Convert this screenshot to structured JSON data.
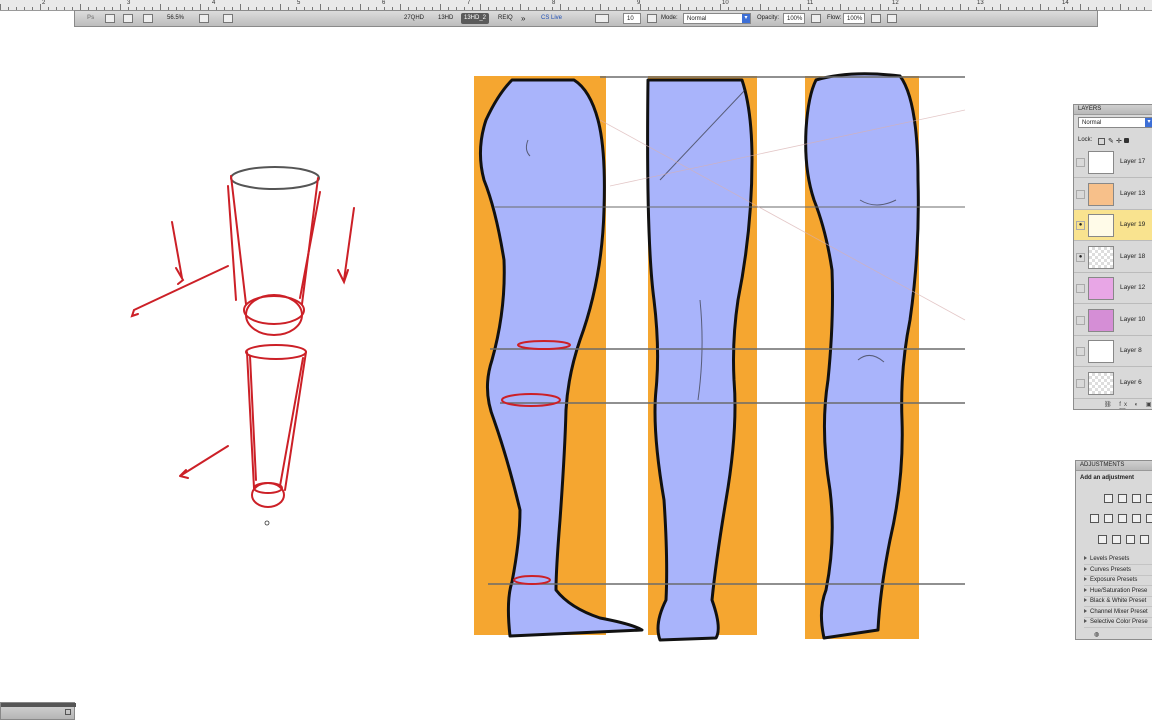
{
  "ruler": {
    "numbers": [
      "2",
      "3",
      "4",
      "5",
      "6",
      "7",
      "8",
      "9",
      "10",
      "11",
      "12",
      "13",
      "14"
    ]
  },
  "app_bar": {
    "logo": "Ps",
    "zoom": "56.5%",
    "workspaces": [
      "27QHD",
      "13HD",
      "13HD_2",
      "REIQ"
    ],
    "active_workspace": "13HD_2",
    "more": "»",
    "cs_live": "CS Live",
    "brush_size": "10",
    "mode_label": "Mode:",
    "mode_value": "Normal",
    "opacity_label": "Opacity:",
    "opacity_value": "100%",
    "flow_label": "Flow:",
    "flow_value": "100%"
  },
  "layers_panel": {
    "title": "LAYERS",
    "blend_mode": "Normal",
    "lock_label": "Lock:",
    "layers": [
      {
        "name": "Layer 17",
        "visible": false,
        "active": false
      },
      {
        "name": "Layer 13",
        "visible": false,
        "active": false
      },
      {
        "name": "Layer 19",
        "visible": true,
        "active": true
      },
      {
        "name": "Layer 18",
        "visible": true,
        "active": false
      },
      {
        "name": "Layer 12",
        "visible": false,
        "active": false
      },
      {
        "name": "Layer 10",
        "visible": false,
        "active": false
      },
      {
        "name": "Layer 8",
        "visible": false,
        "active": false
      },
      {
        "name": "Layer 6",
        "visible": false,
        "active": false
      }
    ]
  },
  "adjustments_panel": {
    "title": "ADJUSTMENTS",
    "subtitle": "Add an adjustment",
    "presets": [
      "Levels Presets",
      "Curves Presets",
      "Exposure Presets",
      "Hue/Saturation Prese",
      "Black & White Preset",
      "Channel Mixer Preset",
      "Selective Color Prese"
    ]
  },
  "colors": {
    "sketch_red": "#cc2027",
    "leg_fill": "#a9b4fb",
    "backdrop_orange": "#f5a630",
    "active_layer": "#f9e38f"
  }
}
